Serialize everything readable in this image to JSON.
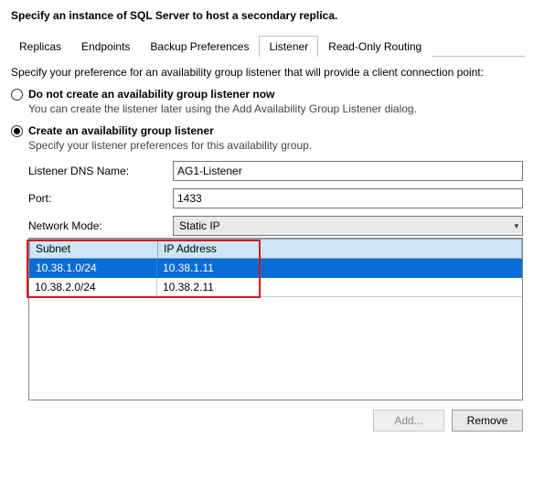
{
  "pageTitle": "Specify an instance of SQL Server to host a secondary replica.",
  "tabs": {
    "replicas": "Replicas",
    "endpoints": "Endpoints",
    "backup": "Backup Preferences",
    "listener": "Listener",
    "routing": "Read-Only Routing"
  },
  "intro": "Specify your preference for an availability group listener that will provide a client connection point:",
  "optNoCreateLabel": "Do not create an availability group listener now",
  "optNoCreateSub": "You can create the listener later using the Add Availability Group Listener dialog.",
  "optCreateLabel": "Create an availability group listener",
  "optCreateSub": "Specify your listener preferences for this availability group.",
  "form": {
    "dnsLabel": "Listener DNS Name:",
    "dnsValue": "AG1-Listener",
    "portLabel": "Port:",
    "portValue": "1433",
    "modeLabel": "Network Mode:",
    "modeValue": "Static IP"
  },
  "gridHeaders": {
    "subnet": "Subnet",
    "ip": "IP Address"
  },
  "rows": [
    {
      "subnet": "10.38.1.0/24",
      "ip": "10.38.1.11",
      "selected": true
    },
    {
      "subnet": "10.38.2.0/24",
      "ip": "10.38.2.11",
      "selected": false
    }
  ],
  "buttons": {
    "add": "Add...",
    "remove": "Remove"
  }
}
